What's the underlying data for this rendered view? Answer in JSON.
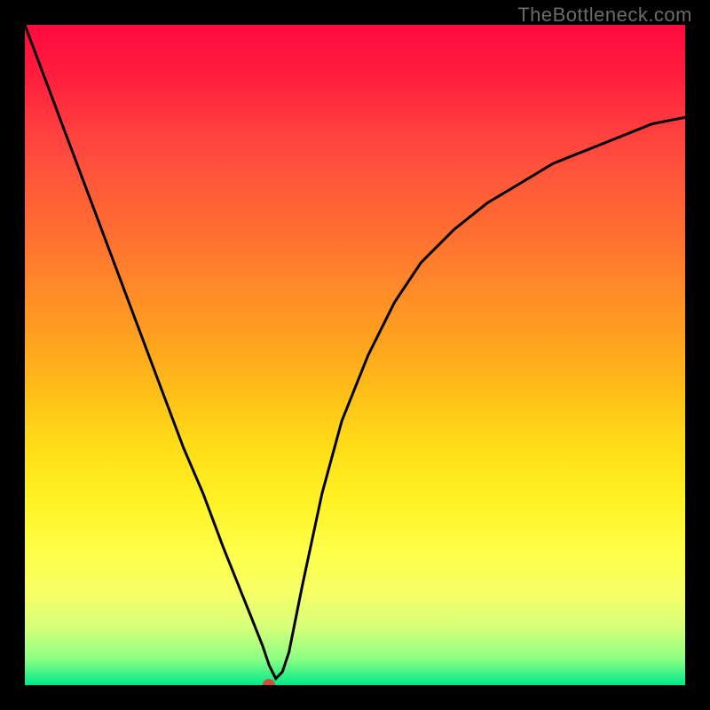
{
  "watermark": "TheBottleneck.com",
  "chart_data": {
    "type": "line",
    "title": "",
    "xlabel": "",
    "ylabel": "",
    "xlim": [
      0,
      100
    ],
    "ylim": [
      0,
      100
    ],
    "series": [
      {
        "name": "curve",
        "x": [
          0,
          3,
          6,
          9,
          12,
          15,
          18,
          21,
          24,
          27,
          30,
          32,
          34,
          36,
          37,
          38,
          39,
          40,
          42,
          45,
          48,
          52,
          56,
          60,
          65,
          70,
          75,
          80,
          85,
          90,
          95,
          100
        ],
        "y": [
          100,
          92,
          84,
          76,
          68,
          60,
          52,
          44,
          36,
          29,
          21,
          16,
          11,
          6,
          3,
          1,
          2,
          5,
          15,
          29,
          40,
          50,
          58,
          64,
          69,
          73,
          76,
          79,
          81,
          83,
          85,
          86
        ]
      }
    ],
    "marker_point": {
      "x": 37,
      "y": 0
    },
    "gradient_stops": [
      {
        "pos": 0,
        "color": "#ff0a3e"
      },
      {
        "pos": 20,
        "color": "#ff5a3a"
      },
      {
        "pos": 40,
        "color": "#ff8a28"
      },
      {
        "pos": 60,
        "color": "#ffdd18"
      },
      {
        "pos": 80,
        "color": "#ffff4a"
      },
      {
        "pos": 100,
        "color": "#00e98b"
      }
    ]
  }
}
